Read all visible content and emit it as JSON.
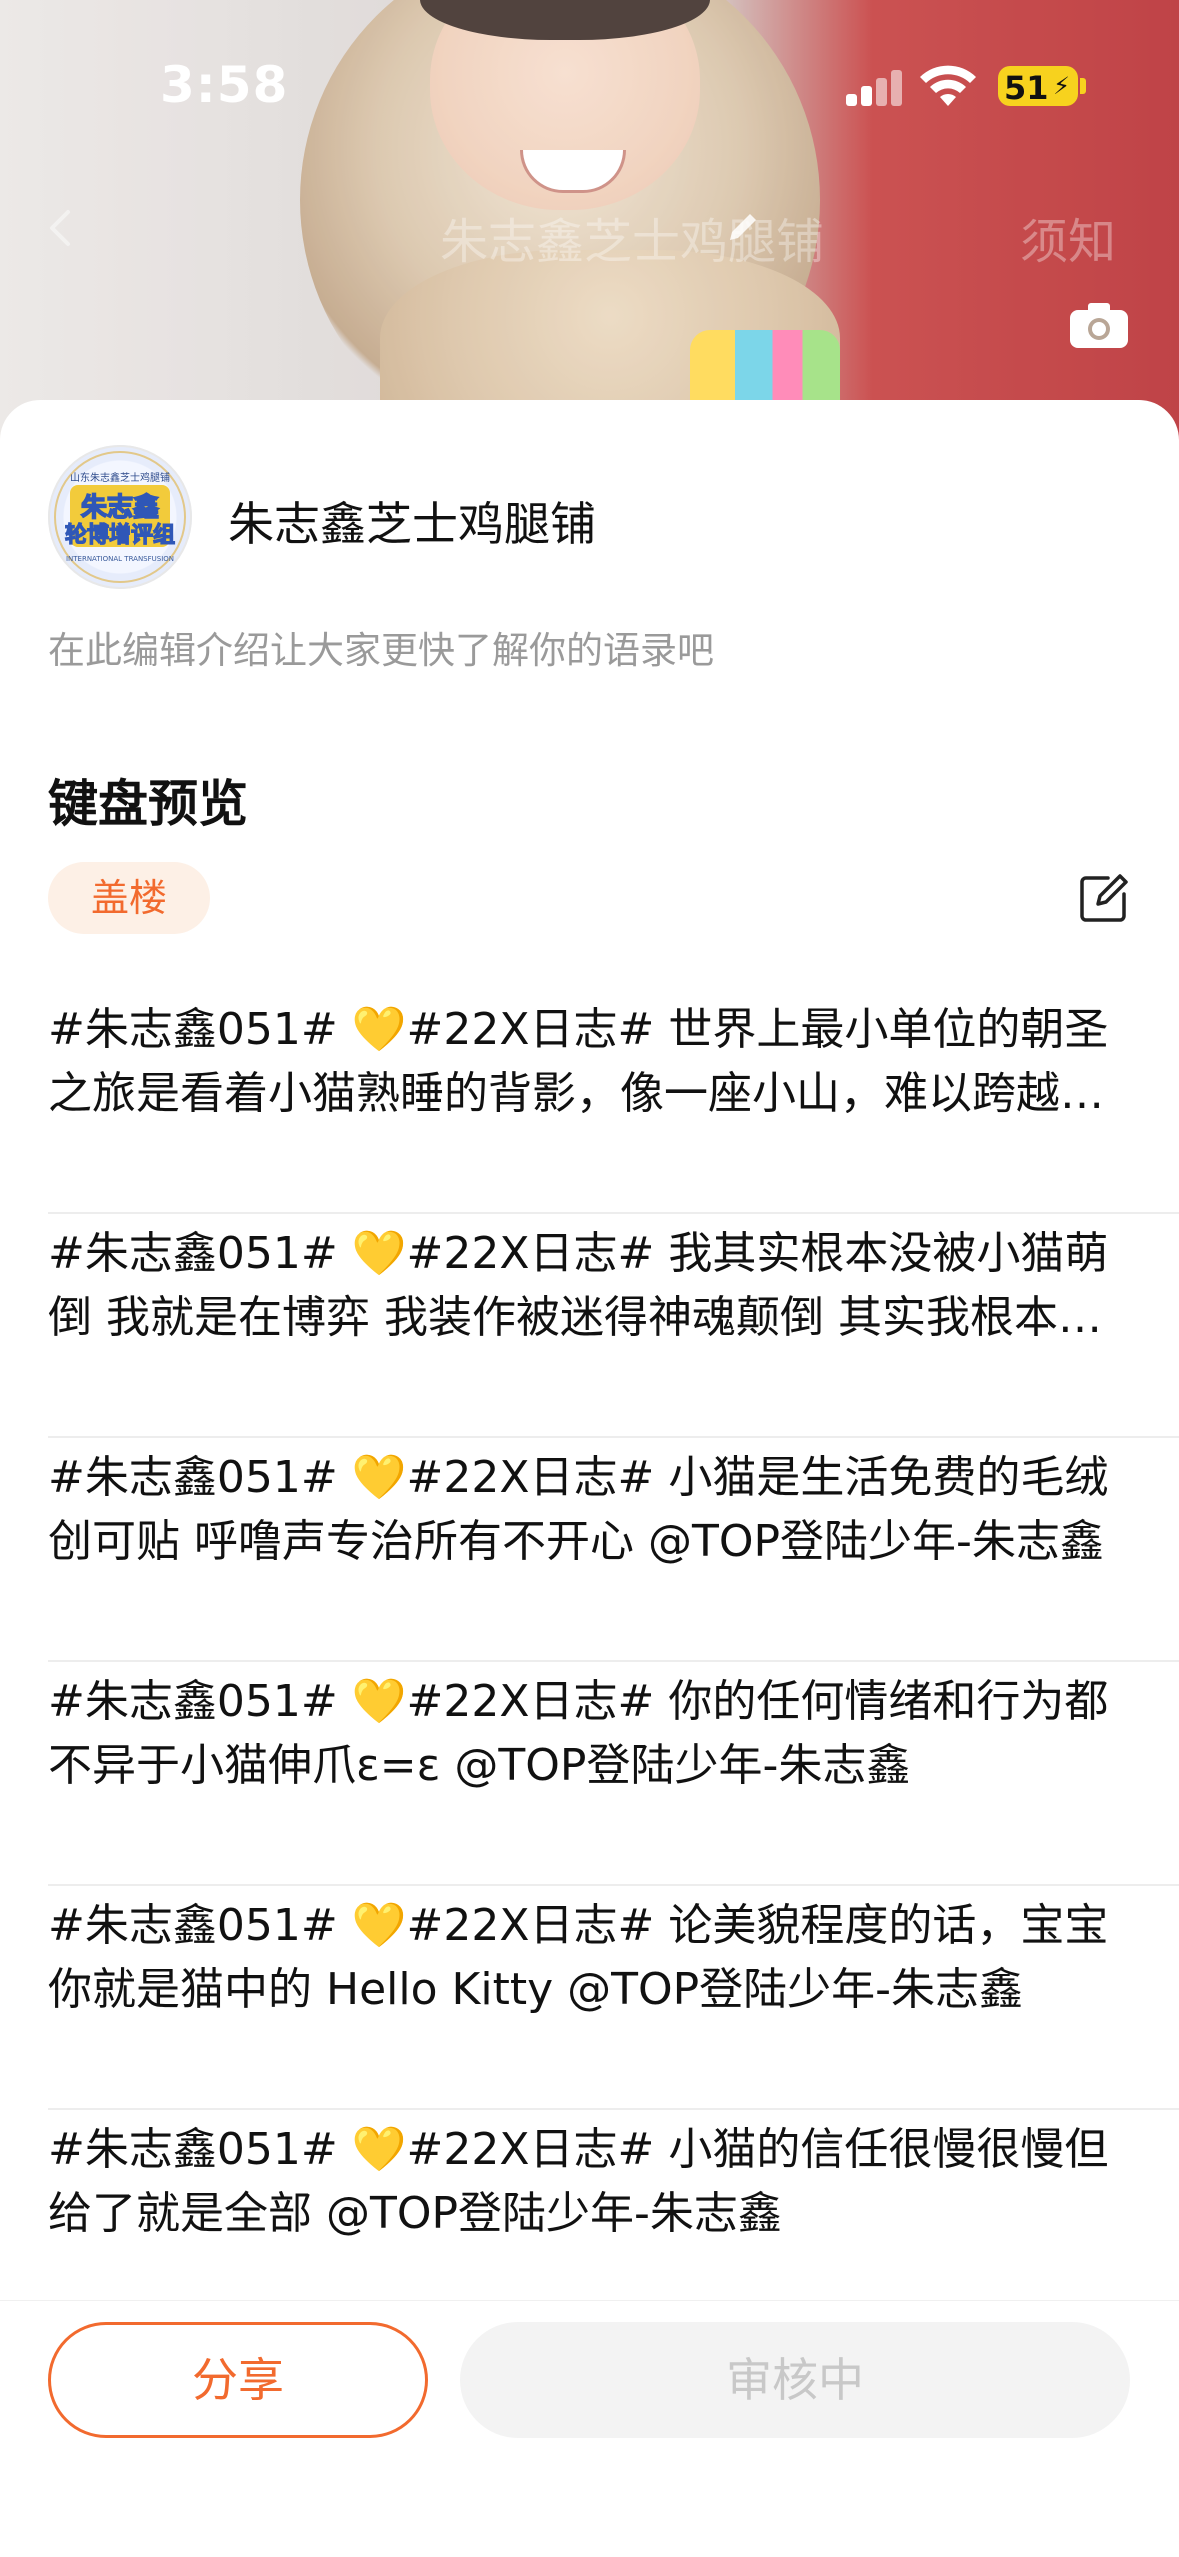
{
  "status_bar": {
    "time": "3:58",
    "battery": "51"
  },
  "nav": {
    "title": "朱志鑫芝士鸡腿铺",
    "notice": "须知"
  },
  "profile": {
    "avatar_text_top": "山东朱志鑫芝士鸡腿铺",
    "avatar_name": "朱志鑫",
    "avatar_sub": "轮博增评组",
    "avatar_eng": "INTERNATIONAL TRANSFUSION",
    "name": "朱志鑫芝士鸡腿铺",
    "bio_placeholder": "在此编辑介绍让大家更快了解你的语录吧"
  },
  "section": {
    "title": "键盘预览",
    "tag": "盖楼"
  },
  "quotes": [
    "#朱志鑫051# 💛#22X日志# 世界上最小单位的朝圣之旅是看着小猫熟睡的背影，像一座小山，难以跨越的温柔",
    "#朱志鑫051# 💛#22X日志# 我其实根本没被小猫萌倒 我就是在博弈 我装作被迷得神魂颠倒 其实我根本没有",
    "#朱志鑫051# 💛#22X日志# 小猫是生活免费的毛绒创可贴 呼噜声专治所有不开心 @TOP登陆少年-朱志鑫",
    "#朱志鑫051# 💛#22X日志#  你的任何情绪和行为都不异于小猫伸爪ε=ε @TOP登陆少年-朱志鑫",
    "#朱志鑫051# 💛#22X日志# 论美貌程度的话，宝宝你就是猫中的 Hello Kitty  @TOP登陆少年-朱志鑫",
    "#朱志鑫051# 💛#22X日志#  小猫的信任很慢很慢但给了就是全部 @TOP登陆少年-朱志鑫"
  ],
  "actions": {
    "share": "分享",
    "review": "审核中"
  },
  "colors": {
    "accent": "#f26a2e",
    "tag_bg": "#fdf0e6",
    "disabled_bg": "#f3f3f3",
    "battery": "#f7d21e"
  },
  "icons": [
    "back-icon",
    "pencil-icon",
    "camera-icon",
    "edit-icon",
    "signal-icon",
    "wifi-icon",
    "battery-icon"
  ]
}
